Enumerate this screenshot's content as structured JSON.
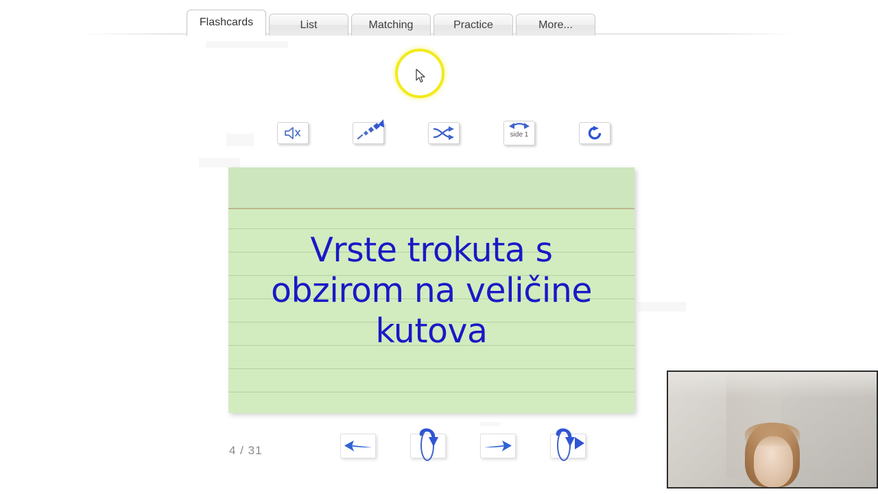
{
  "app": {
    "title": "Flashcards study view"
  },
  "tabs": [
    {
      "label": "Flashcards",
      "active": true,
      "name": "tab-flashcards"
    },
    {
      "label": "List",
      "active": false,
      "name": "tab-list"
    },
    {
      "label": "Matching",
      "active": false,
      "name": "tab-matching"
    },
    {
      "label": "Practice",
      "active": false,
      "name": "tab-practice"
    },
    {
      "label": "More...",
      "active": false,
      "name": "tab-more"
    }
  ],
  "toolbar": {
    "mute_icon": "speaker-mute-icon",
    "autoplay_icon": "dashed-arrow-up-icon",
    "shuffle_icon": "shuffle-icon",
    "side_icon": "double-arrow-icon",
    "side_label": "side 1",
    "restart_icon": "refresh-icon"
  },
  "card": {
    "text": "Vrste trokuta s obzirom na veličine kutova",
    "text_color": "#1a19c6",
    "paper_color": "#d2ecc0",
    "header_rule_color": "#bdb88e"
  },
  "footer": {
    "counter": "4 / 31",
    "prev_icon": "arrow-left-icon",
    "flip_icon": "flip-card-icon",
    "next_icon": "arrow-right-icon",
    "flip_next_icon": "flip-card-next-icon"
  },
  "cursor": {
    "highlight_color": "#f2ea1a",
    "icon": "mouse-pointer-icon"
  },
  "webcam": {
    "label": "webcam-overlay"
  }
}
